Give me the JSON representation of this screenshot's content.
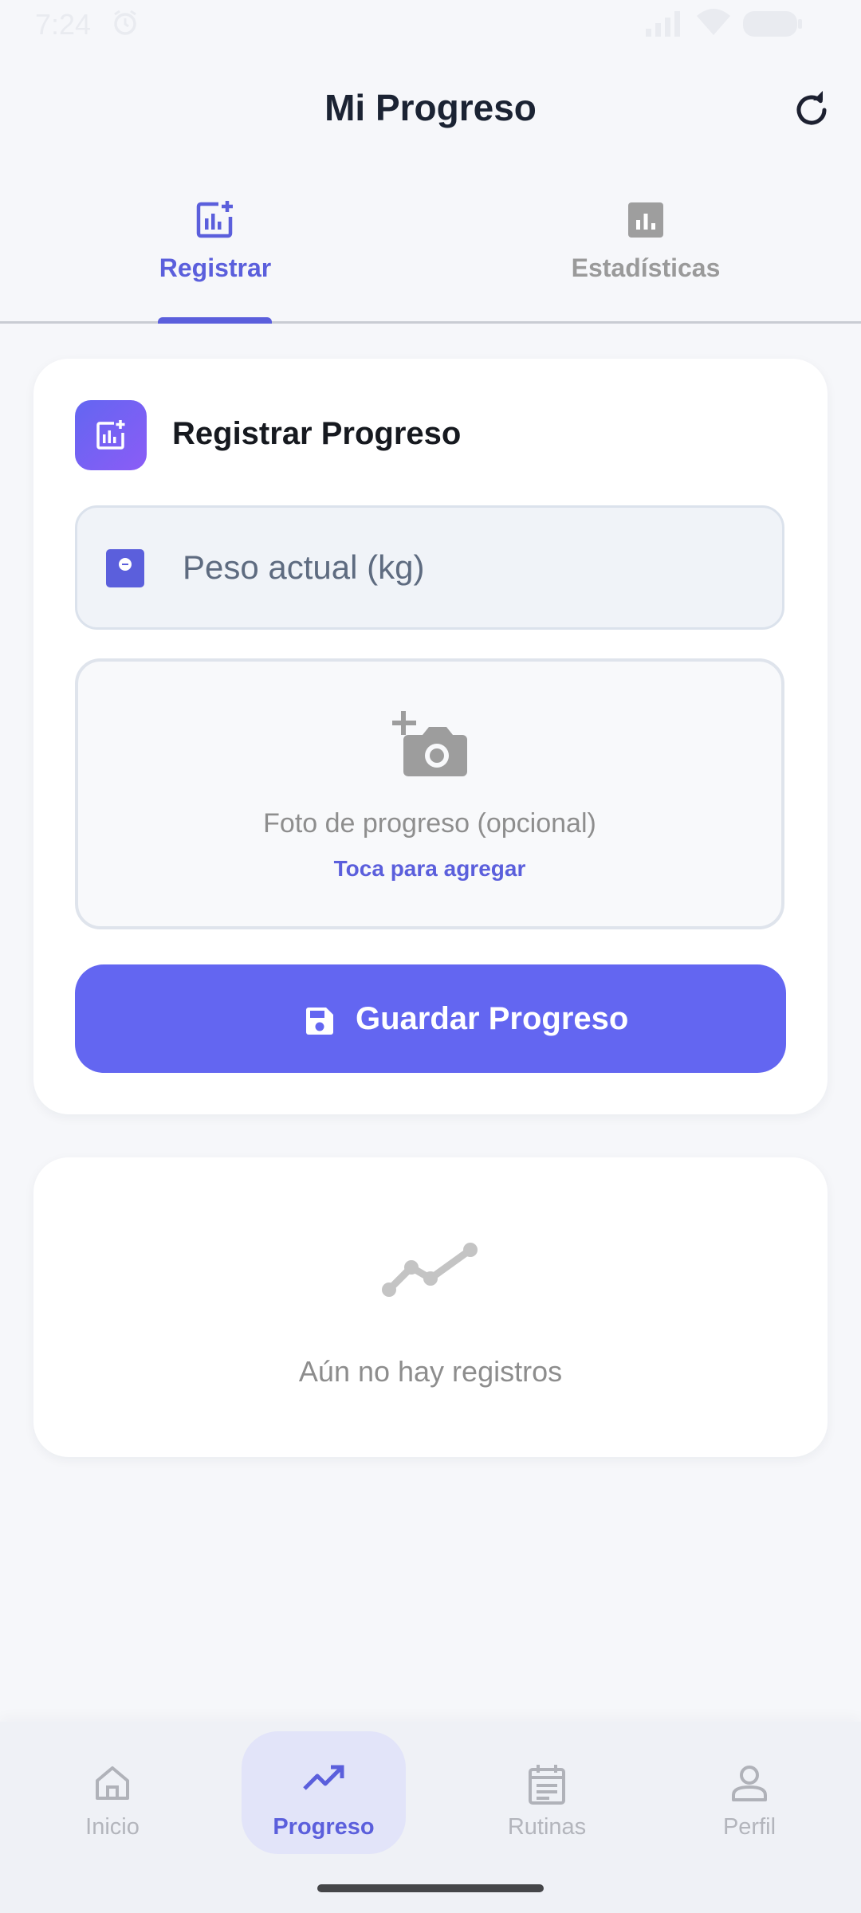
{
  "status_bar": {
    "time": "7:24",
    "icons": [
      "alarm-icon",
      "signal-icon",
      "wifi-icon",
      "battery-icon"
    ]
  },
  "header": {
    "title": "Mi Progreso",
    "refresh_icon": "refresh-icon"
  },
  "tabs": [
    {
      "label": "Registrar",
      "icon": "add-chart-icon",
      "active": true
    },
    {
      "label": "Estadísticas",
      "icon": "bar-chart-icon",
      "active": false
    }
  ],
  "form": {
    "title": "Registrar Progreso",
    "title_icon": "add-chart-icon",
    "weight": {
      "placeholder": "Peso actual (kg)",
      "value": "",
      "icon": "scale-icon"
    },
    "photo": {
      "label": "Foto de progreso (opcional)",
      "action": "Toca para agregar",
      "icon": "add-camera-icon"
    },
    "save": {
      "label": "Guardar Progreso",
      "icon": "save-icon"
    }
  },
  "empty_state": {
    "icon": "trend-line-icon",
    "message": "Aún no hay registros"
  },
  "bottom_nav": [
    {
      "label": "Inicio",
      "icon": "home-icon",
      "active": false
    },
    {
      "label": "Progreso",
      "icon": "trending-up-icon",
      "active": true
    },
    {
      "label": "Rutinas",
      "icon": "calendar-icon",
      "active": false
    },
    {
      "label": "Perfil",
      "icon": "person-icon",
      "active": false
    }
  ],
  "colors": {
    "accent": "#6366f1",
    "accent_text": "#5b5fdc",
    "background": "#f6f7fa",
    "card": "#ffffff",
    "muted_text": "#8e8e8e"
  }
}
